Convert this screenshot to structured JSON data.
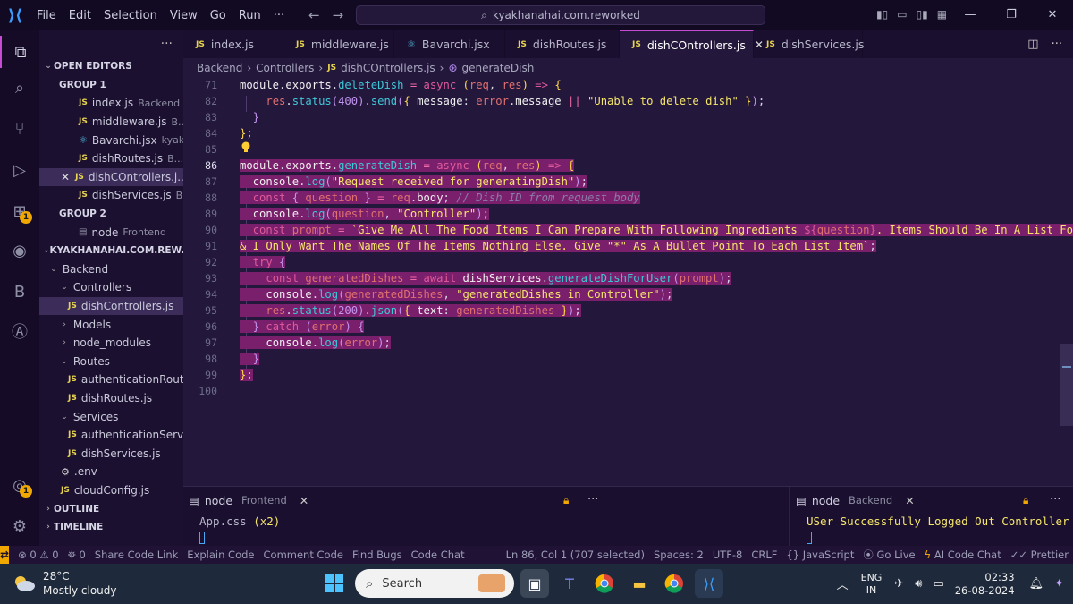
{
  "titlebar": {
    "menu": [
      "File",
      "Edit",
      "Selection",
      "View",
      "Go",
      "Run",
      "···"
    ],
    "search": "kyakhanahai.com.reworked"
  },
  "sidebar": {
    "open_editors_header": "OPEN EDITORS",
    "group1": "GROUP 1",
    "group1_files": [
      {
        "name": "index.js",
        "desc": "Backend"
      },
      {
        "name": "middleware.js",
        "desc": "B..."
      },
      {
        "name": "Bavarchi.jsx",
        "desc": "kyak..."
      },
      {
        "name": "dishRoutes.js",
        "desc": "B..."
      },
      {
        "name": "dishCOntrollers.j...",
        "desc": ""
      },
      {
        "name": "dishServices.js",
        "desc": "B..."
      }
    ],
    "group2": "GROUP 2",
    "group2_files": [
      {
        "name": "node",
        "desc": "Frontend"
      }
    ],
    "project_header": "KYAKHANAHAI.COM.REW...",
    "tree": [
      {
        "label": "Backend",
        "depth": 1,
        "type": "folder-open"
      },
      {
        "label": "Controllers",
        "depth": 2,
        "type": "folder-open"
      },
      {
        "label": "dishControllers.js",
        "depth": 3,
        "type": "js",
        "selected": true
      },
      {
        "label": "Models",
        "depth": 2,
        "type": "folder"
      },
      {
        "label": "node_modules",
        "depth": 2,
        "type": "folder"
      },
      {
        "label": "Routes",
        "depth": 2,
        "type": "folder-open"
      },
      {
        "label": "authenticationRout...",
        "depth": 3,
        "type": "js"
      },
      {
        "label": "dishRoutes.js",
        "depth": 3,
        "type": "js"
      },
      {
        "label": "Services",
        "depth": 2,
        "type": "folder-open"
      },
      {
        "label": "authenticationServi...",
        "depth": 3,
        "type": "js"
      },
      {
        "label": "dishServices.js",
        "depth": 3,
        "type": "js"
      },
      {
        "label": ".env",
        "depth": 2,
        "type": "gear"
      },
      {
        "label": "cloudConfig.js",
        "depth": 2,
        "type": "js"
      }
    ],
    "outline": "OUTLINE",
    "timeline": "TIMELINE"
  },
  "tabs": [
    {
      "label": "index.js",
      "icon": "js"
    },
    {
      "label": "middleware.js",
      "icon": "js"
    },
    {
      "label": "Bavarchi.jsx",
      "icon": "react"
    },
    {
      "label": "dishRoutes.js",
      "icon": "js"
    },
    {
      "label": "dishCOntrollers.js",
      "icon": "js",
      "active": true
    },
    {
      "label": "dishServices.js",
      "icon": "js"
    }
  ],
  "breadcrumb": {
    "parts": [
      "Backend",
      "Controllers",
      "dishCOntrollers.js",
      "generateDish"
    ]
  },
  "editor": {
    "line_numbers": [
      "71",
      "82",
      "83",
      "84",
      "85",
      "86",
      "87",
      "88",
      "89",
      "90",
      "91",
      "92",
      "93",
      "94",
      "95",
      "96",
      "97",
      "98",
      "99",
      "100"
    ],
    "current_line": "86"
  },
  "terminals": {
    "left": {
      "label": "node",
      "sub": "Frontend",
      "output": "App.css (x2)",
      "output_name": "App.css",
      "output_count": "(x2)"
    },
    "right": {
      "label": "node",
      "sub": "Backend",
      "output": "USer Successfully Logged Out Controller"
    }
  },
  "statusbar": {
    "problems": "⊗ 0 ⚠ 0",
    "ports": "⛯ 0",
    "items_left": [
      "Share Code Link",
      "Explain Code",
      "Comment Code",
      "Find Bugs",
      "Code Chat"
    ],
    "position": "Ln 86, Col 1 (707 selected)",
    "spaces": "Spaces: 2",
    "encoding": "UTF-8",
    "eol": "CRLF",
    "language": "{} JavaScript",
    "golive": "Go Live",
    "ai": "AI Code Chat",
    "prettier": "Prettier"
  },
  "taskbar": {
    "temp": "28°C",
    "weather": "Mostly cloudy",
    "search": "Search",
    "lang1": "ENG",
    "lang2": "IN",
    "time": "02:33",
    "date": "26-08-2024"
  },
  "colors": {
    "accent": "#c54bd0",
    "selection": "#7a1f6c",
    "editor_bg": "#24173c",
    "remote": "#f0a800"
  }
}
